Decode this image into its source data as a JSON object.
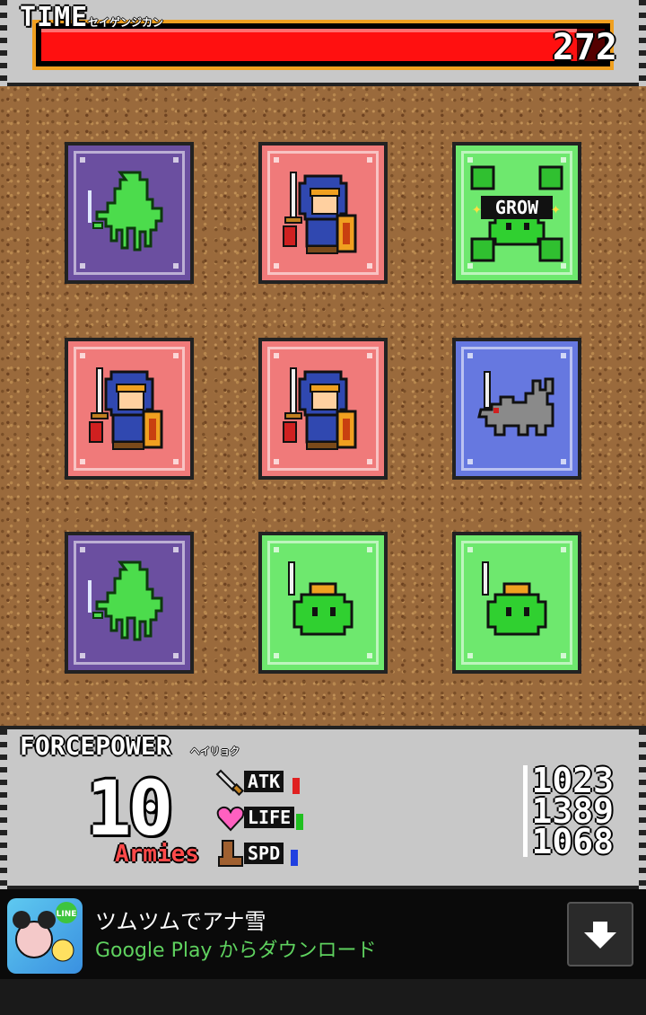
{
  "time": {
    "label": "TIME",
    "sublabel": "セイゲンジカン",
    "value": "272",
    "fill_fraction": 0.95
  },
  "cards": [
    {
      "type": "ghost",
      "color": "purple"
    },
    {
      "type": "knight",
      "color": "red"
    },
    {
      "type": "grow-slime",
      "color": "green",
      "label": "GROW"
    },
    {
      "type": "knight",
      "color": "red"
    },
    {
      "type": "knight",
      "color": "red"
    },
    {
      "type": "wolf",
      "color": "blue"
    },
    {
      "type": "ghost",
      "color": "purple"
    },
    {
      "type": "slime",
      "color": "green"
    },
    {
      "type": "slime",
      "color": "green"
    }
  ],
  "force": {
    "label": "FORCEPOWER",
    "sublabel": "ヘイリョク",
    "armies_count": "10",
    "armies_label": "Armies",
    "stats": [
      {
        "name": "ATK",
        "value": "1023",
        "icon": "sword-icon",
        "bar_color": "#e02020"
      },
      {
        "name": "LIFE",
        "value": "1389",
        "icon": "heart-icon",
        "bar_color": "#20c020"
      },
      {
        "name": "SPD",
        "value": "1068",
        "icon": "boot-icon",
        "bar_color": "#2040e0"
      }
    ]
  },
  "ad": {
    "title": "ツムツムでアナ雪",
    "subtitle": "Google Play からダウンロード",
    "app_icon": "tsum-tsum-app-icon",
    "app_icon_badge": "LINE",
    "button_icon": "download-arrow-icon"
  },
  "colors": {
    "purple_card": "#6b4fa0",
    "red_card": "#f07a7a",
    "green_card": "#6ee86e",
    "blue_card": "#6678e0",
    "time_bar": "#ff1010",
    "dirt": "#9a6a3c"
  }
}
